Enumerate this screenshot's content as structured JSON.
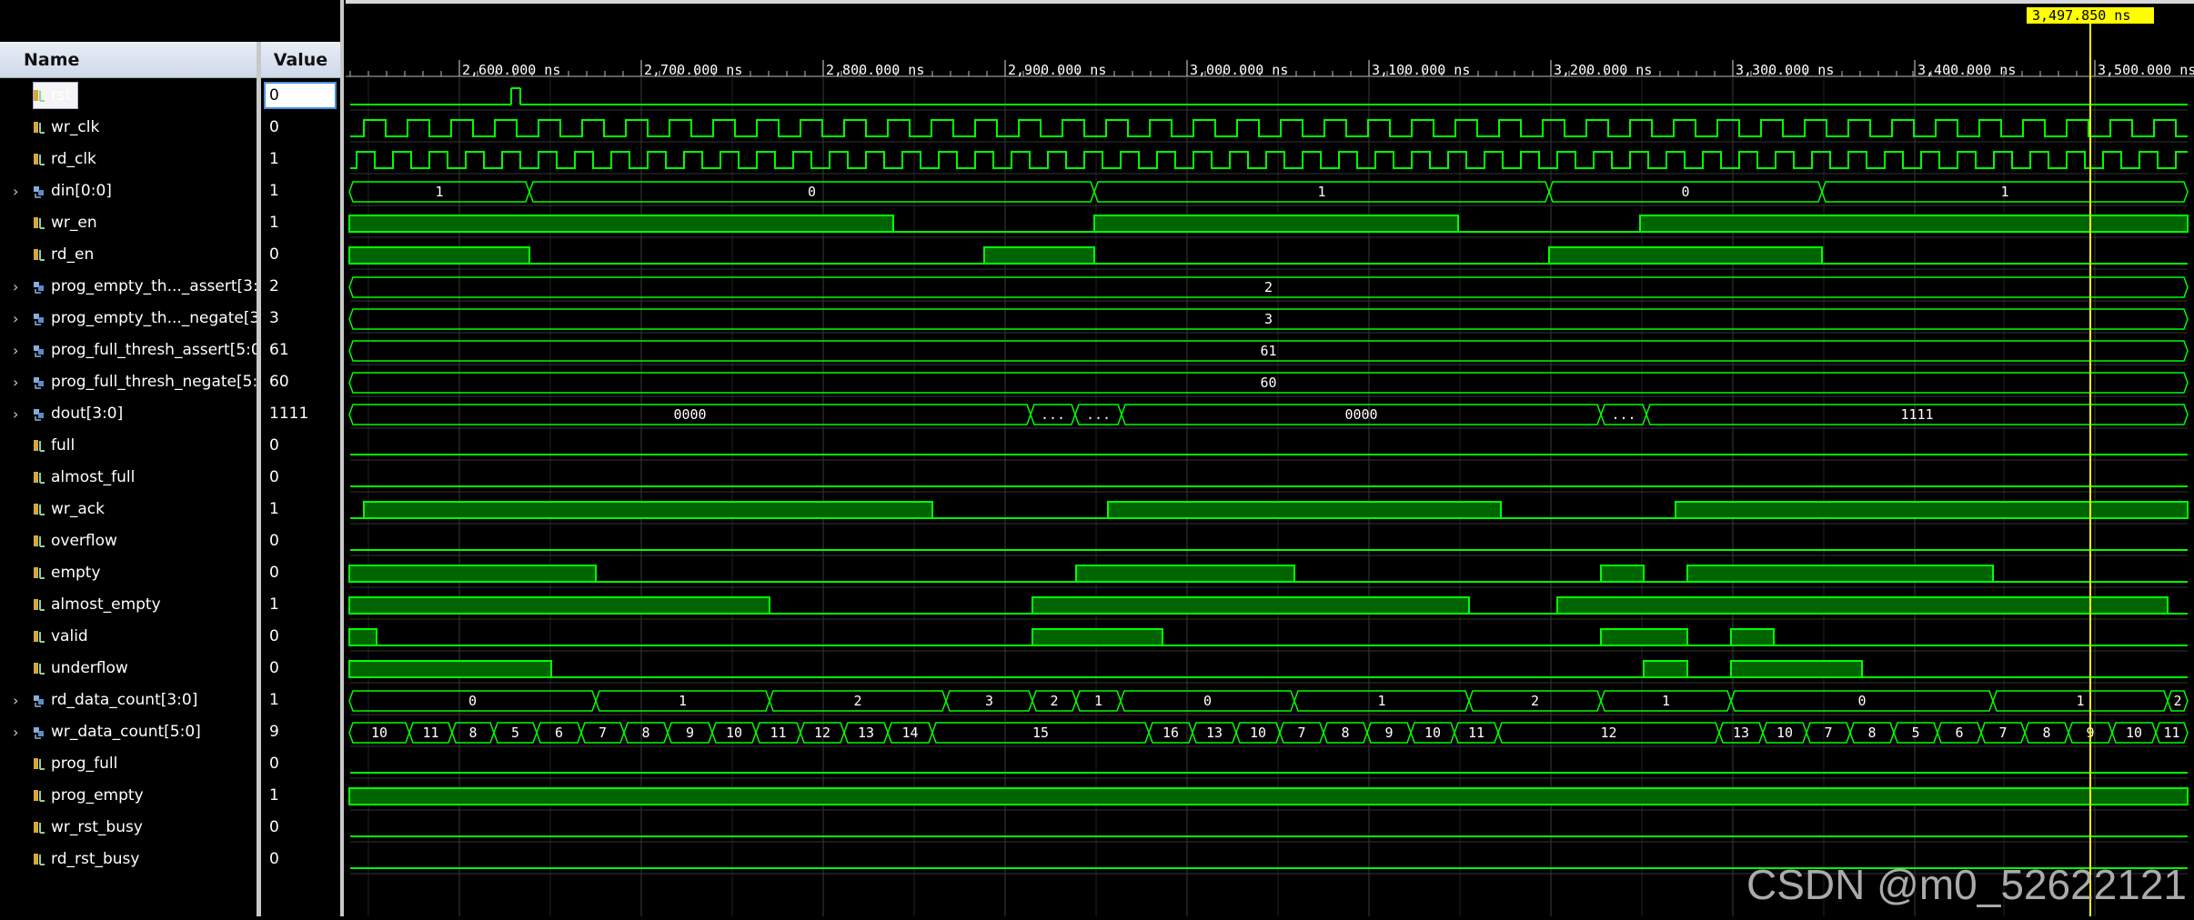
{
  "columns": {
    "name": "Name",
    "value": "Value"
  },
  "cursor_label": "3,497.850 ns",
  "time_ticks": [
    "2,600.000 ns",
    "2,700.000 ns",
    "2,800.000 ns",
    "2,900.000 ns",
    "3,000.000 ns",
    "3,100.000 ns",
    "3,200.000 ns",
    "3,300.000 ns",
    "3,400.000 ns",
    "3,500.000 ns"
  ],
  "signals": [
    {
      "name": "rst",
      "value": "0",
      "expandable": false,
      "bus": false
    },
    {
      "name": "wr_clk",
      "value": "0",
      "expandable": false,
      "bus": false
    },
    {
      "name": "rd_clk",
      "value": "1",
      "expandable": false,
      "bus": false
    },
    {
      "name": "din[0:0]",
      "value": "1",
      "expandable": true,
      "bus": true
    },
    {
      "name": "wr_en",
      "value": "1",
      "expandable": false,
      "bus": false
    },
    {
      "name": "rd_en",
      "value": "0",
      "expandable": false,
      "bus": false
    },
    {
      "name": "prog_empty_th..._assert[3:0]",
      "value": "2",
      "expandable": true,
      "bus": true
    },
    {
      "name": "prog_empty_th..._negate[3:0]",
      "value": "3",
      "expandable": true,
      "bus": true
    },
    {
      "name": "prog_full_thresh_assert[5:0]",
      "value": "61",
      "expandable": true,
      "bus": true
    },
    {
      "name": "prog_full_thresh_negate[5:0]",
      "value": "60",
      "expandable": true,
      "bus": true
    },
    {
      "name": "dout[3:0]",
      "value": "1111",
      "expandable": true,
      "bus": true
    },
    {
      "name": "full",
      "value": "0",
      "expandable": false,
      "bus": false
    },
    {
      "name": "almost_full",
      "value": "0",
      "expandable": false,
      "bus": false
    },
    {
      "name": "wr_ack",
      "value": "1",
      "expandable": false,
      "bus": false
    },
    {
      "name": "overflow",
      "value": "0",
      "expandable": false,
      "bus": false
    },
    {
      "name": "empty",
      "value": "0",
      "expandable": false,
      "bus": false
    },
    {
      "name": "almost_empty",
      "value": "1",
      "expandable": false,
      "bus": false
    },
    {
      "name": "valid",
      "value": "0",
      "expandable": false,
      "bus": false
    },
    {
      "name": "underflow",
      "value": "0",
      "expandable": false,
      "bus": false
    },
    {
      "name": "rd_data_count[3:0]",
      "value": "1",
      "expandable": true,
      "bus": true
    },
    {
      "name": "wr_data_count[5:0]",
      "value": "9",
      "expandable": true,
      "bus": true
    },
    {
      "name": "prog_full",
      "value": "0",
      "expandable": false,
      "bus": false
    },
    {
      "name": "prog_empty",
      "value": "1",
      "expandable": false,
      "bus": false
    },
    {
      "name": "wr_rst_busy",
      "value": "0",
      "expandable": false,
      "bus": false
    },
    {
      "name": "rd_rst_busy",
      "value": "0",
      "expandable": false,
      "bus": false
    }
  ],
  "waves": {
    "din": [
      "1",
      "0",
      "1",
      "0",
      "1"
    ],
    "prog_empty_thresh_assert": [
      "2"
    ],
    "prog_empty_thresh_negate": [
      "3"
    ],
    "prog_full_thresh_assert": [
      "61"
    ],
    "prog_full_thresh_negate": [
      "60"
    ],
    "dout": [
      "0000",
      "...",
      "...",
      "0000",
      "...",
      "1111"
    ],
    "rd_data_count": [
      "0",
      "1",
      "2",
      "3",
      "2",
      "1",
      "0",
      "1",
      "2",
      "1",
      "0",
      "1",
      "2"
    ],
    "wr_data_count": [
      "10",
      "11",
      "8",
      "5",
      "6",
      "7",
      "8",
      "9",
      "10",
      "11",
      "12",
      "13",
      "14",
      "15",
      "16",
      "13",
      "10",
      "7",
      "8",
      "9",
      "10",
      "11",
      "12",
      "13",
      "10",
      "7",
      "8",
      "5",
      "6",
      "7",
      "8",
      "9",
      "10",
      "11"
    ]
  },
  "colors": {
    "wave": "#00ff00",
    "fill": "#006400",
    "grid": "#2b2b2b",
    "cursor": "#ffff00"
  },
  "watermark": "CSDN @m0_52622121"
}
